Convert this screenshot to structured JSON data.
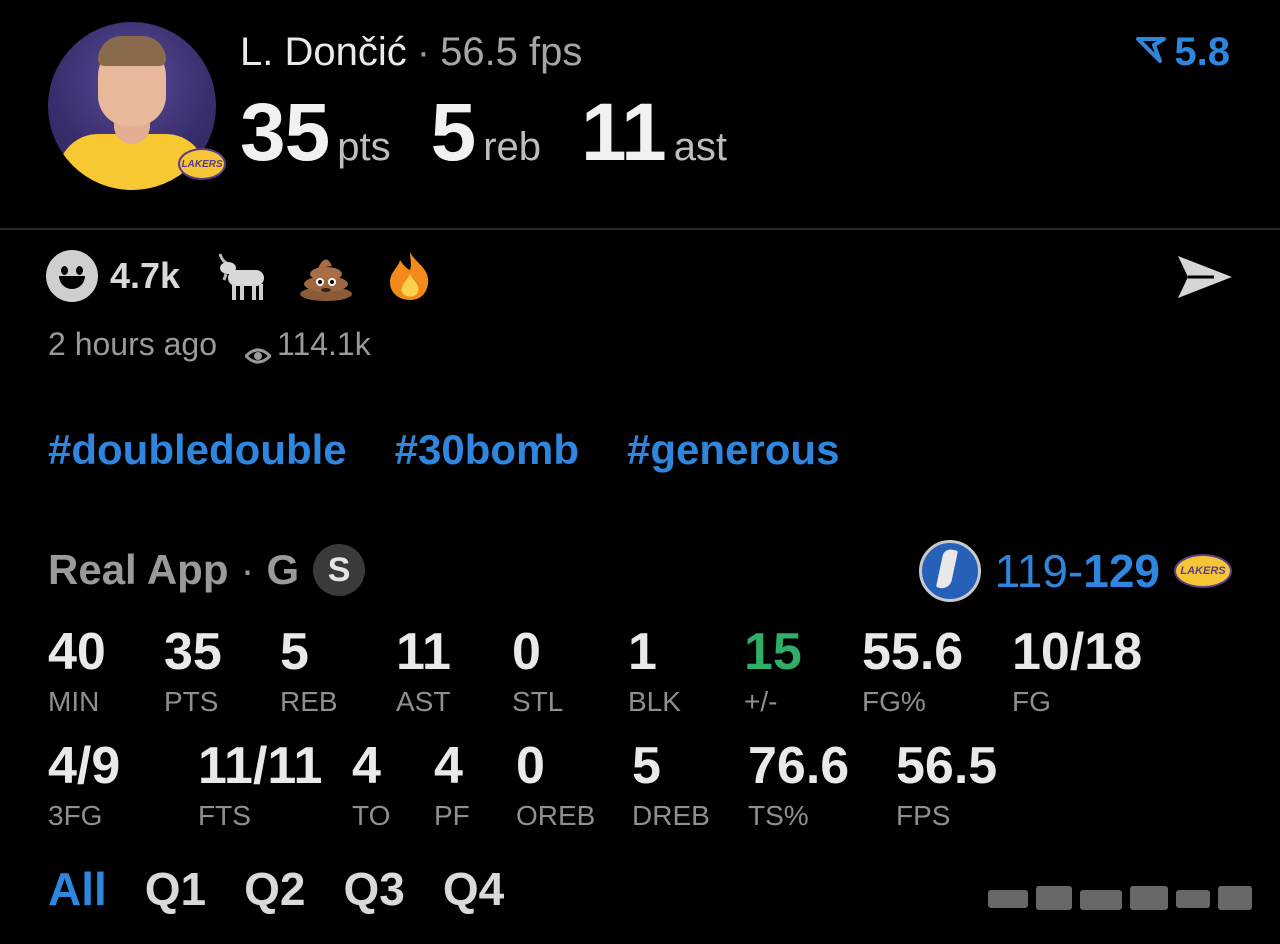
{
  "player": {
    "name": "L. Dončić",
    "fps_line": "56.5 fps",
    "team_logo_text": "LAKERS"
  },
  "headline": {
    "pts": "35",
    "pts_unit": "pts",
    "reb": "5",
    "reb_unit": "reb",
    "ast": "11",
    "ast_unit": "ast"
  },
  "rating": {
    "value": "5.8",
    "icon": "rating-arrow-icon",
    "color": "#2f86de"
  },
  "reactions": {
    "count": "4.7k",
    "emojis": [
      "goat-emoji",
      "poop-emoji",
      "fire-emoji"
    ]
  },
  "meta": {
    "time_ago": "2 hours ago",
    "views": "114.1k"
  },
  "tags": [
    "#doubledouble",
    "#30bomb",
    "#generous"
  ],
  "source": {
    "app": "Real App",
    "position": "G",
    "badge": "S"
  },
  "game": {
    "score_left": "119",
    "score_right": "129",
    "dash": "-",
    "home_logo_text": "LAKERS"
  },
  "stats": [
    {
      "value": "40",
      "label": "MIN"
    },
    {
      "value": "35",
      "label": "PTS"
    },
    {
      "value": "5",
      "label": "REB"
    },
    {
      "value": "11",
      "label": "AST"
    },
    {
      "value": "0",
      "label": "STL"
    },
    {
      "value": "1",
      "label": "BLK"
    },
    {
      "value": "15",
      "label": "+/-"
    },
    {
      "value": "55.6",
      "label": "FG%"
    },
    {
      "value": "10/18",
      "label": "FG"
    },
    {
      "value": "4/9",
      "label": "3FG"
    },
    {
      "value": "11/11",
      "label": "FTS"
    },
    {
      "value": "4",
      "label": "TO"
    },
    {
      "value": "4",
      "label": "PF"
    },
    {
      "value": "0",
      "label": "OREB"
    },
    {
      "value": "5",
      "label": "DREB"
    },
    {
      "value": "76.6",
      "label": "TS%"
    },
    {
      "value": "56.5",
      "label": "FPS"
    }
  ],
  "colors": {
    "accent": "#2f86de",
    "positive": "#2fae6a",
    "background": "#000000"
  },
  "periods": {
    "active": "All",
    "items": [
      "All",
      "Q1",
      "Q2",
      "Q3",
      "Q4"
    ]
  }
}
